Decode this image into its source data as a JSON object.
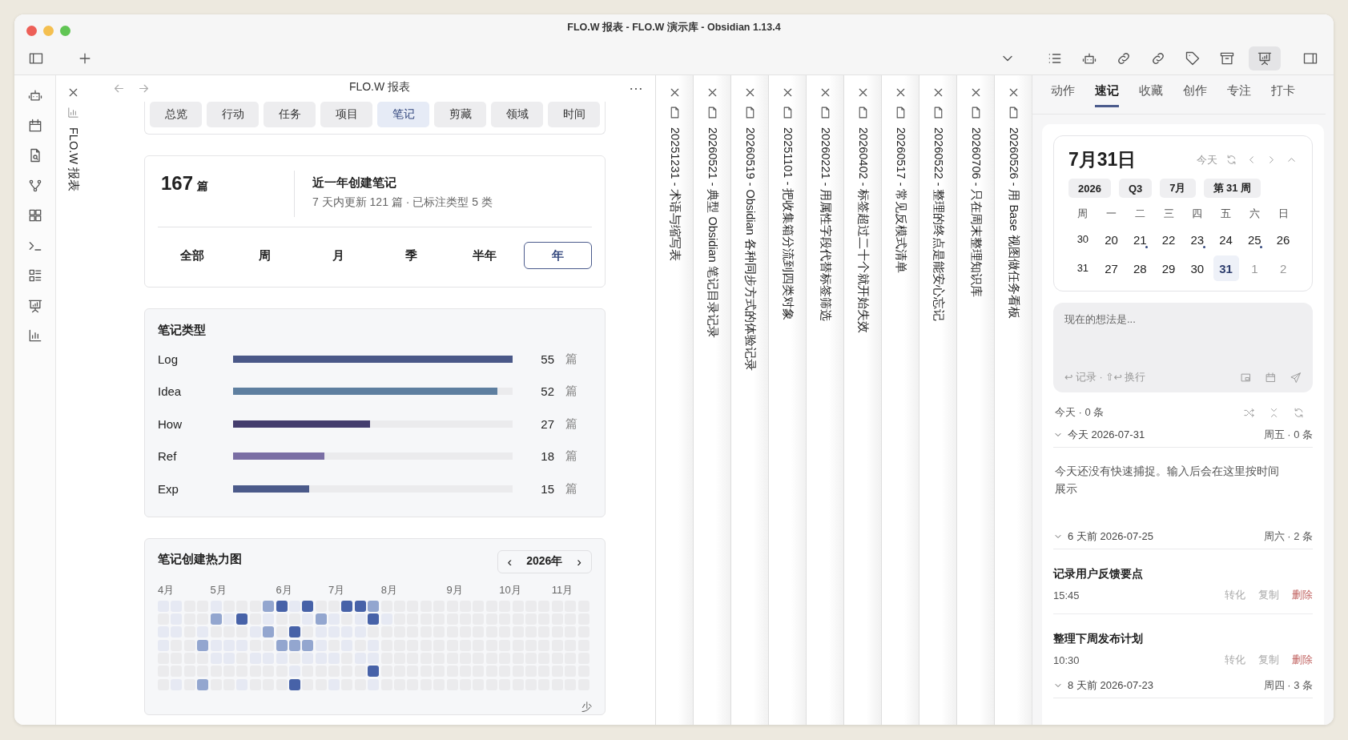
{
  "window": {
    "title": "FLO.W 报表 - FLO.W 演示库 - Obsidian 1.13.4"
  },
  "collapsed_tab": {
    "title": "FLO.W 报表"
  },
  "pane": {
    "title": "FLO.W 报表"
  },
  "report_tabs": [
    {
      "label": "总览",
      "selected": false
    },
    {
      "label": "行动",
      "selected": false
    },
    {
      "label": "任务",
      "selected": false
    },
    {
      "label": "项目",
      "selected": false
    },
    {
      "label": "笔记",
      "selected": true
    },
    {
      "label": "剪藏",
      "selected": false
    },
    {
      "label": "领域",
      "selected": false
    },
    {
      "label": "时间",
      "selected": false
    }
  ],
  "summary": {
    "count": "167",
    "unit": "篇",
    "title": "近一年创建笔记",
    "subtitle": "7 天内更新 121 篇 · 已标注类型 5 类"
  },
  "ranges": [
    {
      "label": "全部",
      "selected": false
    },
    {
      "label": "周",
      "selected": false
    },
    {
      "label": "月",
      "selected": false
    },
    {
      "label": "季",
      "selected": false
    },
    {
      "label": "半年",
      "selected": false
    },
    {
      "label": "年",
      "selected": true
    }
  ],
  "note_types": {
    "title": "笔记类型",
    "rows": [
      {
        "name": "Log",
        "level": 1,
        "color": "#4a5888",
        "count": "55",
        "unit": "篇"
      },
      {
        "name": "Idea",
        "level": 0.945,
        "color": "#5e7fa0",
        "count": "52",
        "unit": "篇"
      },
      {
        "name": "How",
        "level": 0.49,
        "color": "#443d6e",
        "count": "27",
        "unit": "篇"
      },
      {
        "name": "Ref",
        "level": 0.327,
        "color": "#7a6ea4",
        "count": "18",
        "unit": "篇"
      },
      {
        "name": "Exp",
        "level": 0.273,
        "color": "#4b5a8a",
        "count": "15",
        "unit": "篇"
      }
    ]
  },
  "heatmap": {
    "title": "笔记创建热力图",
    "prev": "‹",
    "year": "2026年",
    "next": "›",
    "legend": "少",
    "weeks": [
      {
        "month": "4月",
        "days": [
          {
            "kind": "faint"
          },
          {
            "kind": "empty"
          },
          {
            "kind": "faint"
          },
          {
            "kind": "faint"
          },
          {
            "kind": "empty"
          },
          {
            "kind": "empty"
          },
          {
            "kind": "empty"
          }
        ]
      },
      {
        "days": [
          {
            "kind": "faint"
          },
          {
            "kind": "faint"
          },
          {
            "kind": "faint"
          },
          {
            "kind": "empty"
          },
          {
            "kind": "empty"
          },
          {
            "kind": "empty"
          },
          {
            "kind": "faint"
          }
        ]
      },
      {
        "days": [
          {
            "kind": "empty"
          },
          {
            "kind": "empty"
          },
          {
            "kind": "empty"
          },
          {
            "kind": "empty"
          },
          {
            "kind": "empty"
          },
          {
            "kind": "empty"
          },
          {
            "kind": "empty"
          }
        ]
      },
      {
        "days": [
          {
            "kind": "empty"
          },
          {
            "kind": "empty"
          },
          {
            "kind": "faint"
          },
          {
            "kind": "light"
          },
          {
            "kind": "empty"
          },
          {
            "kind": "empty"
          },
          {
            "kind": "light"
          }
        ]
      },
      {
        "month": "5月",
        "days": [
          {
            "kind": "faint"
          },
          {
            "kind": "light"
          },
          {
            "kind": "empty"
          },
          {
            "kind": "faint"
          },
          {
            "kind": "faint"
          },
          {
            "kind": "empty"
          },
          {
            "kind": "empty"
          }
        ]
      },
      {
        "days": [
          {
            "kind": "empty"
          },
          {
            "kind": "faint"
          },
          {
            "kind": "empty"
          },
          {
            "kind": "faint"
          },
          {
            "kind": "faint"
          },
          {
            "kind": "empty"
          },
          {
            "kind": "empty"
          }
        ]
      },
      {
        "days": [
          {
            "kind": "empty"
          },
          {
            "kind": "dark"
          },
          {
            "kind": "empty"
          },
          {
            "kind": "faint"
          },
          {
            "kind": "empty"
          },
          {
            "kind": "empty"
          },
          {
            "kind": "faint"
          }
        ]
      },
      {
        "days": [
          {
            "kind": "empty"
          },
          {
            "kind": "empty"
          },
          {
            "kind": "faint"
          },
          {
            "kind": "empty"
          },
          {
            "kind": "faint"
          },
          {
            "kind": "empty"
          },
          {
            "kind": "empty"
          }
        ]
      },
      {
        "days": [
          {
            "kind": "light"
          },
          {
            "kind": "faint"
          },
          {
            "kind": "light"
          },
          {
            "kind": "empty"
          },
          {
            "kind": "faint"
          },
          {
            "kind": "empty"
          },
          {
            "kind": "empty"
          }
        ]
      },
      {
        "month": "6月",
        "days": [
          {
            "kind": "dark"
          },
          {
            "kind": "empty"
          },
          {
            "kind": "empty"
          },
          {
            "kind": "light"
          },
          {
            "kind": "faint"
          },
          {
            "kind": "empty"
          },
          {
            "kind": "empty"
          }
        ]
      },
      {
        "days": [
          {
            "kind": "faint"
          },
          {
            "kind": "empty"
          },
          {
            "kind": "dark"
          },
          {
            "kind": "light"
          },
          {
            "kind": "empty"
          },
          {
            "kind": "faint"
          },
          {
            "kind": "dark"
          }
        ]
      },
      {
        "days": [
          {
            "kind": "dark"
          },
          {
            "kind": "faint"
          },
          {
            "kind": "empty"
          },
          {
            "kind": "light"
          },
          {
            "kind": "faint"
          },
          {
            "kind": "empty"
          },
          {
            "kind": "empty"
          }
        ]
      },
      {
        "days": [
          {
            "kind": "empty"
          },
          {
            "kind": "light"
          },
          {
            "kind": "faint"
          },
          {
            "kind": "faint"
          },
          {
            "kind": "faint"
          },
          {
            "kind": "empty"
          },
          {
            "kind": "empty"
          }
        ]
      },
      {
        "month": "7月",
        "days": [
          {
            "kind": "empty"
          },
          {
            "kind": "faint"
          },
          {
            "kind": "faint"
          },
          {
            "kind": "empty"
          },
          {
            "kind": "faint"
          },
          {
            "kind": "empty"
          },
          {
            "kind": "faint"
          }
        ]
      },
      {
        "days": [
          {
            "kind": "dark"
          },
          {
            "kind": "empty"
          },
          {
            "kind": "faint"
          },
          {
            "kind": "faint"
          },
          {
            "kind": "empty"
          },
          {
            "kind": "empty"
          },
          {
            "kind": "empty"
          }
        ]
      },
      {
        "days": [
          {
            "kind": "dark"
          },
          {
            "kind": "faint"
          },
          {
            "kind": "faint"
          },
          {
            "kind": "empty"
          },
          {
            "kind": "faint"
          },
          {
            "kind": "empty"
          },
          {
            "kind": "empty"
          }
        ]
      },
      {
        "days": [
          {
            "kind": "light"
          },
          {
            "kind": "dark"
          },
          {
            "kind": "empty"
          },
          {
            "kind": "faint"
          },
          {
            "kind": "faint"
          },
          {
            "kind": "dark"
          },
          {
            "kind": "faint"
          }
        ]
      },
      {
        "month": "8月",
        "days": [
          {
            "kind": "empty"
          },
          {
            "kind": "faint"
          },
          {
            "kind": "empty"
          },
          {
            "kind": "empty"
          },
          {
            "kind": "empty"
          },
          {
            "kind": "empty"
          },
          {
            "kind": "empty"
          }
        ]
      },
      {
        "days": [
          {
            "kind": "empty"
          },
          {
            "kind": "empty"
          },
          {
            "kind": "empty"
          },
          {
            "kind": "empty"
          },
          {
            "kind": "empty"
          },
          {
            "kind": "empty"
          },
          {
            "kind": "empty"
          }
        ]
      },
      {
        "days": [
          {
            "kind": "empty"
          },
          {
            "kind": "empty"
          },
          {
            "kind": "empty"
          },
          {
            "kind": "empty"
          },
          {
            "kind": "empty"
          },
          {
            "kind": "empty"
          },
          {
            "kind": "empty"
          }
        ]
      },
      {
        "days": [
          {
            "kind": "empty"
          },
          {
            "kind": "empty"
          },
          {
            "kind": "empty"
          },
          {
            "kind": "empty"
          },
          {
            "kind": "empty"
          },
          {
            "kind": "empty"
          },
          {
            "kind": "empty"
          }
        ]
      },
      {
        "days": [
          {
            "kind": "empty"
          },
          {
            "kind": "empty"
          },
          {
            "kind": "empty"
          },
          {
            "kind": "empty"
          },
          {
            "kind": "empty"
          },
          {
            "kind": "empty"
          },
          {
            "kind": "empty"
          }
        ]
      },
      {
        "month": "9月",
        "days": [
          {
            "kind": "empty"
          },
          {
            "kind": "empty"
          },
          {
            "kind": "empty"
          },
          {
            "kind": "empty"
          },
          {
            "kind": "empty"
          },
          {
            "kind": "empty"
          },
          {
            "kind": "empty"
          }
        ]
      },
      {
        "days": [
          {
            "kind": "empty"
          },
          {
            "kind": "empty"
          },
          {
            "kind": "empty"
          },
          {
            "kind": "empty"
          },
          {
            "kind": "empty"
          },
          {
            "kind": "empty"
          },
          {
            "kind": "empty"
          }
        ]
      },
      {
        "days": [
          {
            "kind": "empty"
          },
          {
            "kind": "empty"
          },
          {
            "kind": "empty"
          },
          {
            "kind": "empty"
          },
          {
            "kind": "empty"
          },
          {
            "kind": "empty"
          },
          {
            "kind": "empty"
          }
        ]
      },
      {
        "days": [
          {
            "kind": "empty"
          },
          {
            "kind": "empty"
          },
          {
            "kind": "empty"
          },
          {
            "kind": "empty"
          },
          {
            "kind": "empty"
          },
          {
            "kind": "empty"
          },
          {
            "kind": "empty"
          }
        ]
      },
      {
        "month": "10月",
        "days": [
          {
            "kind": "empty"
          },
          {
            "kind": "empty"
          },
          {
            "kind": "empty"
          },
          {
            "kind": "empty"
          },
          {
            "kind": "empty"
          },
          {
            "kind": "empty"
          },
          {
            "kind": "empty"
          }
        ]
      },
      {
        "days": [
          {
            "kind": "empty"
          },
          {
            "kind": "empty"
          },
          {
            "kind": "empty"
          },
          {
            "kind": "empty"
          },
          {
            "kind": "empty"
          },
          {
            "kind": "empty"
          },
          {
            "kind": "empty"
          }
        ]
      },
      {
        "days": [
          {
            "kind": "empty"
          },
          {
            "kind": "empty"
          },
          {
            "kind": "empty"
          },
          {
            "kind": "empty"
          },
          {
            "kind": "empty"
          },
          {
            "kind": "empty"
          },
          {
            "kind": "empty"
          }
        ]
      },
      {
        "days": [
          {
            "kind": "empty"
          },
          {
            "kind": "empty"
          },
          {
            "kind": "empty"
          },
          {
            "kind": "empty"
          },
          {
            "kind": "empty"
          },
          {
            "kind": "empty"
          },
          {
            "kind": "empty"
          }
        ]
      },
      {
        "month": "11月",
        "days": [
          {
            "kind": "empty"
          },
          {
            "kind": "empty"
          },
          {
            "kind": "empty"
          },
          {
            "kind": "empty"
          },
          {
            "kind": "empty"
          },
          {
            "kind": "empty"
          },
          {
            "kind": "empty"
          }
        ]
      },
      {
        "days": [
          {
            "kind": "empty"
          },
          {
            "kind": "empty"
          },
          {
            "kind": "empty"
          },
          {
            "kind": "empty"
          },
          {
            "kind": "empty"
          },
          {
            "kind": "empty"
          },
          {
            "kind": "empty"
          }
        ]
      },
      {
        "days": [
          {
            "kind": "empty"
          },
          {
            "kind": "empty"
          },
          {
            "kind": "empty"
          },
          {
            "kind": "empty"
          },
          {
            "kind": "empty"
          },
          {
            "kind": "empty"
          },
          {
            "kind": "empty"
          }
        ]
      }
    ]
  },
  "stacked_tabs": [
    {
      "title": "20251231 - 术语与缩写表"
    },
    {
      "title": "20260521 - 典型 Obsidian 笔记目录记录"
    },
    {
      "title": "20260519 - Obsidian 各种同步方式的体验记录"
    },
    {
      "title": "20251101 - 把收集箱分流到四类对象"
    },
    {
      "title": "20260221 - 用属性字段代替标签筛选"
    },
    {
      "title": "20260402 - 标签超过二十个就开始失效"
    },
    {
      "title": "20260517 - 常见反模式清单"
    },
    {
      "title": "20260522 - 整理的终点是能安心忘记"
    },
    {
      "title": "20260706 - 只在周末整理知识库"
    },
    {
      "title": "20260526 - 用 Base 视图做任务看板"
    }
  ],
  "sidebar": {
    "tabs": [
      {
        "label": "动作",
        "selected": false
      },
      {
        "label": "速记",
        "selected": true
      },
      {
        "label": "收藏",
        "selected": false
      },
      {
        "label": "创作",
        "selected": false
      },
      {
        "label": "专注",
        "selected": false
      },
      {
        "label": "打卡",
        "selected": false
      }
    ],
    "calendar": {
      "date": "7月31日",
      "today": "今天",
      "chips": [
        "2026",
        "Q3",
        "7月",
        "第 31 周"
      ],
      "weekdays": [
        "周",
        "一",
        "二",
        "三",
        "四",
        "五",
        "六",
        "日"
      ],
      "weeks": [
        {
          "number": "30",
          "days": [
            {
              "label": "20",
              "dot": false,
              "selected": false,
              "muted": false
            },
            {
              "label": "21",
              "dot": true,
              "selected": false,
              "muted": false
            },
            {
              "label": "22",
              "dot": false,
              "selected": false,
              "muted": false
            },
            {
              "label": "23",
              "dot": true,
              "selected": false,
              "muted": false
            },
            {
              "label": "24",
              "dot": false,
              "selected": false,
              "muted": false
            },
            {
              "label": "25",
              "dot": true,
              "selected": false,
              "muted": false
            },
            {
              "label": "26",
              "dot": false,
              "selected": false,
              "muted": false
            }
          ]
        },
        {
          "number": "31",
          "days": [
            {
              "label": "27",
              "dot": false,
              "selected": false,
              "muted": false
            },
            {
              "label": "28",
              "dot": false,
              "selected": false,
              "muted": false
            },
            {
              "label": "29",
              "dot": false,
              "selected": false,
              "muted": false
            },
            {
              "label": "30",
              "dot": false,
              "selected": false,
              "muted": false
            },
            {
              "label": "31",
              "dot": false,
              "selected": true,
              "muted": false
            },
            {
              "label": "1",
              "dot": false,
              "selected": false,
              "muted": true
            },
            {
              "label": "2",
              "dot": false,
              "selected": false,
              "muted": true
            }
          ]
        }
      ]
    },
    "capture": {
      "placeholder": "现在的想法是...",
      "hint": "↩ 记录 · ⇧↩ 换行"
    },
    "list": {
      "summary": "今天 · 0 条",
      "groups": [
        {
          "title": "今天 2026-07-31",
          "meta": "周五 · 0 条",
          "expanded": true,
          "empty": "今天还没有快速捕捉。输入后会在这里按时间展示"
        },
        {
          "title": "6 天前 2026-07-25",
          "meta": "周六 · 2 条",
          "expanded": true,
          "items": [
            {
              "title": "记录用户反馈要点",
              "time": "15:45",
              "actions": [
                {
                  "label": "转化",
                  "kind": "normal"
                },
                {
                  "label": "复制",
                  "kind": "normal"
                },
                {
                  "label": "删除",
                  "kind": "danger"
                }
              ]
            },
            {
              "title": "整理下周发布计划",
              "time": "10:30",
              "actions": [
                {
                  "label": "转化",
                  "kind": "normal"
                },
                {
                  "label": "复制",
                  "kind": "normal"
                },
                {
                  "label": "删除",
                  "kind": "danger"
                }
              ]
            }
          ]
        },
        {
          "title": "8 天前 2026-07-23",
          "meta": "周四 · 3 条",
          "expanded": true
        }
      ]
    }
  }
}
